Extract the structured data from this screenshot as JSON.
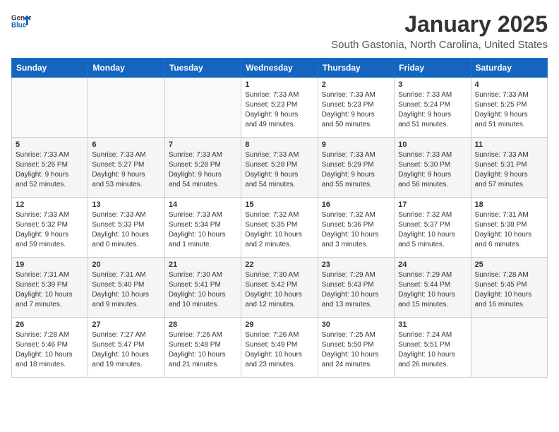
{
  "header": {
    "logo_general": "General",
    "logo_blue": "Blue",
    "month_title": "January 2025",
    "location": "South Gastonia, North Carolina, United States"
  },
  "weekdays": [
    "Sunday",
    "Monday",
    "Tuesday",
    "Wednesday",
    "Thursday",
    "Friday",
    "Saturday"
  ],
  "weeks": [
    [
      {
        "day": "",
        "info": ""
      },
      {
        "day": "",
        "info": ""
      },
      {
        "day": "",
        "info": ""
      },
      {
        "day": "1",
        "info": "Sunrise: 7:33 AM\nSunset: 5:23 PM\nDaylight: 9 hours\nand 49 minutes."
      },
      {
        "day": "2",
        "info": "Sunrise: 7:33 AM\nSunset: 5:23 PM\nDaylight: 9 hours\nand 50 minutes."
      },
      {
        "day": "3",
        "info": "Sunrise: 7:33 AM\nSunset: 5:24 PM\nDaylight: 9 hours\nand 51 minutes."
      },
      {
        "day": "4",
        "info": "Sunrise: 7:33 AM\nSunset: 5:25 PM\nDaylight: 9 hours\nand 51 minutes."
      }
    ],
    [
      {
        "day": "5",
        "info": "Sunrise: 7:33 AM\nSunset: 5:26 PM\nDaylight: 9 hours\nand 52 minutes."
      },
      {
        "day": "6",
        "info": "Sunrise: 7:33 AM\nSunset: 5:27 PM\nDaylight: 9 hours\nand 53 minutes."
      },
      {
        "day": "7",
        "info": "Sunrise: 7:33 AM\nSunset: 5:28 PM\nDaylight: 9 hours\nand 54 minutes."
      },
      {
        "day": "8",
        "info": "Sunrise: 7:33 AM\nSunset: 5:28 PM\nDaylight: 9 hours\nand 54 minutes."
      },
      {
        "day": "9",
        "info": "Sunrise: 7:33 AM\nSunset: 5:29 PM\nDaylight: 9 hours\nand 55 minutes."
      },
      {
        "day": "10",
        "info": "Sunrise: 7:33 AM\nSunset: 5:30 PM\nDaylight: 9 hours\nand 56 minutes."
      },
      {
        "day": "11",
        "info": "Sunrise: 7:33 AM\nSunset: 5:31 PM\nDaylight: 9 hours\nand 57 minutes."
      }
    ],
    [
      {
        "day": "12",
        "info": "Sunrise: 7:33 AM\nSunset: 5:32 PM\nDaylight: 9 hours\nand 59 minutes."
      },
      {
        "day": "13",
        "info": "Sunrise: 7:33 AM\nSunset: 5:33 PM\nDaylight: 10 hours\nand 0 minutes."
      },
      {
        "day": "14",
        "info": "Sunrise: 7:33 AM\nSunset: 5:34 PM\nDaylight: 10 hours\nand 1 minute."
      },
      {
        "day": "15",
        "info": "Sunrise: 7:32 AM\nSunset: 5:35 PM\nDaylight: 10 hours\nand 2 minutes."
      },
      {
        "day": "16",
        "info": "Sunrise: 7:32 AM\nSunset: 5:36 PM\nDaylight: 10 hours\nand 3 minutes."
      },
      {
        "day": "17",
        "info": "Sunrise: 7:32 AM\nSunset: 5:37 PM\nDaylight: 10 hours\nand 5 minutes."
      },
      {
        "day": "18",
        "info": "Sunrise: 7:31 AM\nSunset: 5:38 PM\nDaylight: 10 hours\nand 6 minutes."
      }
    ],
    [
      {
        "day": "19",
        "info": "Sunrise: 7:31 AM\nSunset: 5:39 PM\nDaylight: 10 hours\nand 7 minutes."
      },
      {
        "day": "20",
        "info": "Sunrise: 7:31 AM\nSunset: 5:40 PM\nDaylight: 10 hours\nand 9 minutes."
      },
      {
        "day": "21",
        "info": "Sunrise: 7:30 AM\nSunset: 5:41 PM\nDaylight: 10 hours\nand 10 minutes."
      },
      {
        "day": "22",
        "info": "Sunrise: 7:30 AM\nSunset: 5:42 PM\nDaylight: 10 hours\nand 12 minutes."
      },
      {
        "day": "23",
        "info": "Sunrise: 7:29 AM\nSunset: 5:43 PM\nDaylight: 10 hours\nand 13 minutes."
      },
      {
        "day": "24",
        "info": "Sunrise: 7:29 AM\nSunset: 5:44 PM\nDaylight: 10 hours\nand 15 minutes."
      },
      {
        "day": "25",
        "info": "Sunrise: 7:28 AM\nSunset: 5:45 PM\nDaylight: 10 hours\nand 16 minutes."
      }
    ],
    [
      {
        "day": "26",
        "info": "Sunrise: 7:28 AM\nSunset: 5:46 PM\nDaylight: 10 hours\nand 18 minutes."
      },
      {
        "day": "27",
        "info": "Sunrise: 7:27 AM\nSunset: 5:47 PM\nDaylight: 10 hours\nand 19 minutes."
      },
      {
        "day": "28",
        "info": "Sunrise: 7:26 AM\nSunset: 5:48 PM\nDaylight: 10 hours\nand 21 minutes."
      },
      {
        "day": "29",
        "info": "Sunrise: 7:26 AM\nSunset: 5:49 PM\nDaylight: 10 hours\nand 23 minutes."
      },
      {
        "day": "30",
        "info": "Sunrise: 7:25 AM\nSunset: 5:50 PM\nDaylight: 10 hours\nand 24 minutes."
      },
      {
        "day": "31",
        "info": "Sunrise: 7:24 AM\nSunset: 5:51 PM\nDaylight: 10 hours\nand 26 minutes."
      },
      {
        "day": "",
        "info": ""
      }
    ]
  ]
}
